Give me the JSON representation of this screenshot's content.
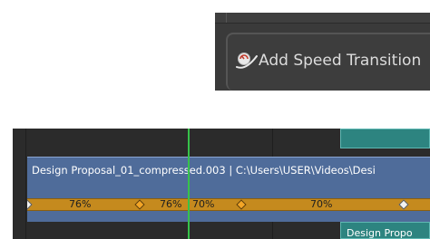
{
  "context_menu": {
    "add_speed_transition_label": "Add Speed Transition",
    "icon": "speed-gauge-icon"
  },
  "timeline": {
    "clip": {
      "label": "Design Proposal_01_compressed.003 | C:\\Users\\USER\\Videos\\Desi",
      "color": "#4f6c9a"
    },
    "speed_bar": {
      "color": "#c58a1e",
      "segments": [
        {
          "value": "76%"
        },
        {
          "value": "76%"
        },
        {
          "value": "70%"
        },
        {
          "value": "70%"
        }
      ]
    },
    "next_clip": {
      "label": "Design Propo",
      "color": "#2d8480"
    },
    "playhead_color": "#37c24a"
  }
}
